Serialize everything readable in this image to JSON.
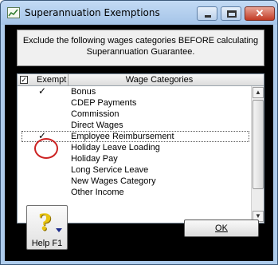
{
  "window": {
    "title": "Superannuation Exemptions"
  },
  "instruction": "Exclude the following wages categories BEFORE calculating Superannuation Guarantee.",
  "grid": {
    "header_check": "✓",
    "col_exempt": "Exempt",
    "col_wages": "Wage Categories",
    "rows": [
      {
        "label": "Bonus",
        "check": "✓"
      },
      {
        "label": "CDEP Payments",
        "check": ""
      },
      {
        "label": "Commission",
        "check": ""
      },
      {
        "label": "Direct Wages",
        "check": ""
      },
      {
        "label": "Employee Reimbursement",
        "check": "✓"
      },
      {
        "label": "Holiday Leave Loading",
        "check": ""
      },
      {
        "label": "Holiday Pay",
        "check": ""
      },
      {
        "label": "Long Service Leave",
        "check": ""
      },
      {
        "label": "New Wages Category",
        "check": ""
      },
      {
        "label": "Other Income",
        "check": ""
      }
    ],
    "selected_index": 4
  },
  "buttons": {
    "help_label": "Help F1",
    "ok_label": "OK"
  },
  "icons": {
    "app": "calculator-icon",
    "help": "question-mark-icon",
    "minimize": "minimize-icon",
    "maximize": "maximize-icon",
    "close": "close-icon",
    "scroll_up": "scroll-up-arrow-icon",
    "scroll_down": "scroll-down-arrow-icon"
  },
  "colors": {
    "highlight_circle": "#cc2222",
    "title_bar": "#b4d0f0"
  }
}
